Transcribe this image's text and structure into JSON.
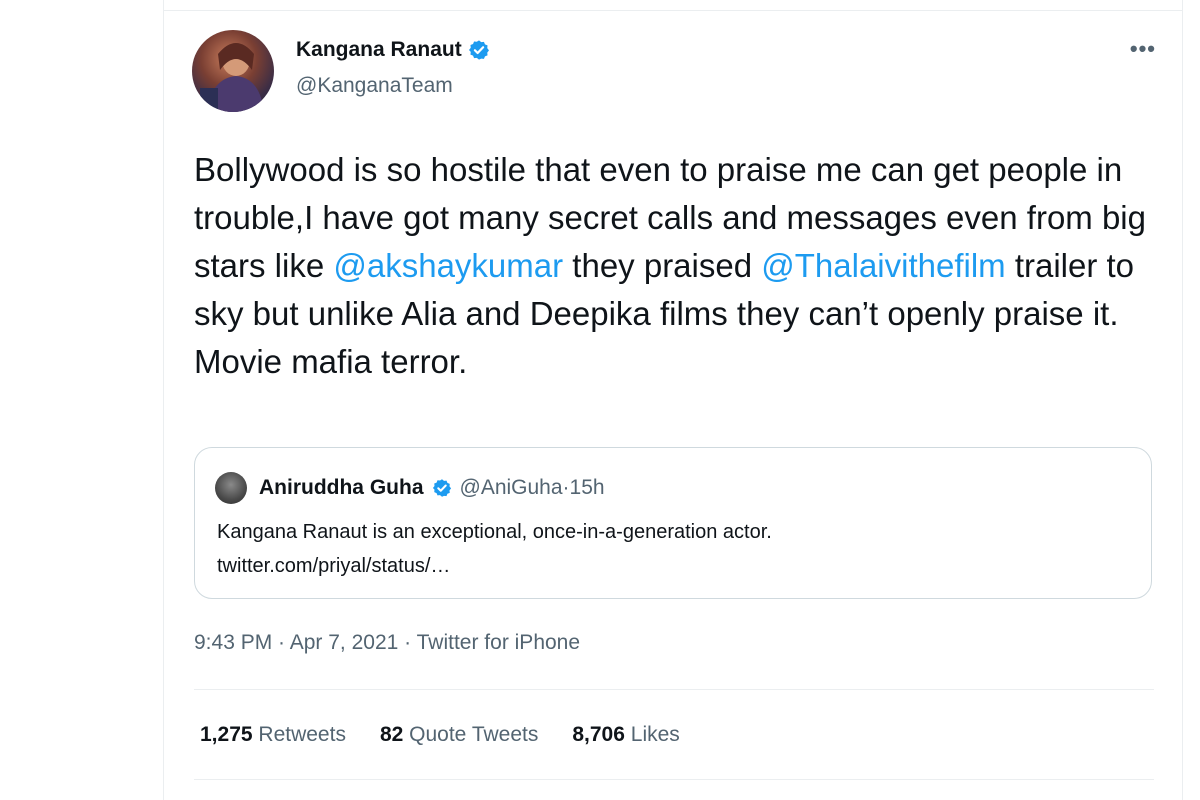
{
  "tweet": {
    "author": {
      "name": "Kangana Ranaut",
      "handle": "@KanganaTeam"
    },
    "more_label": "•••",
    "text_parts": {
      "p1": "Bollywood is so hostile that even to praise me can get people in trouble,I have got many secret calls and messages even from big stars like ",
      "mention1": "@akshaykumar",
      "p2": " they praised ",
      "mention2": "@Thalaivithefilm",
      "p3": " trailer to sky but unlike Alia and Deepika films they can’t openly praise it. Movie mafia terror."
    },
    "quoted": {
      "name": "Aniruddha Guha",
      "handle": "@AniGuha",
      "separator": " · ",
      "time": "15h",
      "line1": "Kangana Ranaut is an exceptional, once-in-a-generation actor.",
      "line2": "twitter.com/priyal/status/…"
    },
    "meta": {
      "time": "9:43 PM",
      "separator": " · ",
      "date": "Apr 7, 2021",
      "source": "Twitter for iPhone"
    },
    "stats": {
      "retweets_count": "1,275",
      "retweets_label": "Retweets",
      "quotes_count": "82",
      "quotes_label": "Quote Tweets",
      "likes_count": "8,706",
      "likes_label": "Likes"
    }
  },
  "colors": {
    "link": "#1d9bf0",
    "verified": "#1d9bf0",
    "secondary_text": "#536471"
  }
}
